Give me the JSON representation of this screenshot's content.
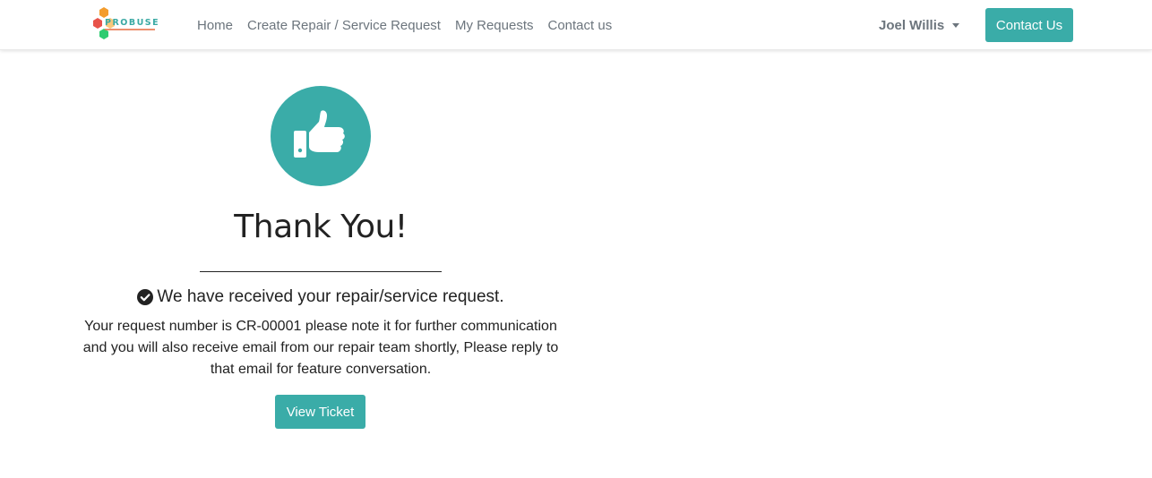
{
  "brand": {
    "name": "PROBUSE",
    "accent": "#3aaca8"
  },
  "nav": {
    "links": [
      {
        "label": "Home"
      },
      {
        "label": "Create Repair / Service Request"
      },
      {
        "label": "My Requests"
      },
      {
        "label": "Contact us"
      }
    ],
    "user_name": "Joel Willis",
    "contact_button": "Contact Us"
  },
  "main": {
    "icon": "thumbs-up-icon",
    "title": "Thank You!",
    "received_text": "We have received your repair/service request.",
    "message": "Your request number is CR-00001 please note it for further communication and you will also receive email from our repair team shortly, Please reply to that email for feature conversation.",
    "view_ticket_button": "View Ticket"
  }
}
